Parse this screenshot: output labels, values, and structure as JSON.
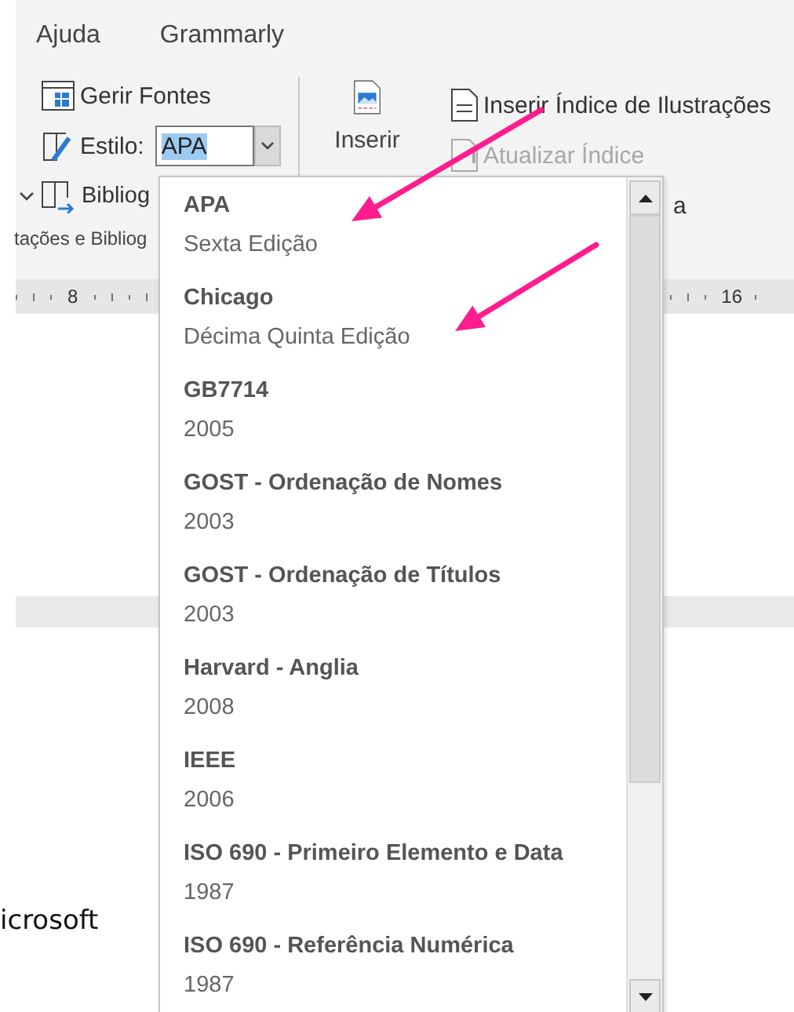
{
  "ribbon_tabs": [
    {
      "label": "Ajuda"
    },
    {
      "label": "Grammarly"
    }
  ],
  "citations_group": {
    "manage_sources": "Gerir Fontes",
    "style_label": "Estilo:",
    "style_value": "APA",
    "bibliography": "Bibliog",
    "group_label": "tações e Bibliog"
  },
  "captions_group": {
    "insert_caption": "Inserir",
    "insert_table_of_figures": "Inserir Índice de Ilustrações",
    "update_table": {
      "label": "Atualizar Índice",
      "disabled": true
    },
    "cross_reference": "a"
  },
  "ruler": {
    "labels": [
      "8",
      "16"
    ]
  },
  "document": {
    "text": "icrosoft"
  },
  "style_dropdown": {
    "items": [
      {
        "name": "APA",
        "edition": "Sexta Edição"
      },
      {
        "name": "Chicago",
        "edition": "Décima Quinta Edição"
      },
      {
        "name": "GB7714",
        "edition": "2005"
      },
      {
        "name": "GOST - Ordenação de Nomes",
        "edition": "2003"
      },
      {
        "name": "GOST - Ordenação de Títulos",
        "edition": "2003"
      },
      {
        "name": "Harvard - Anglia",
        "edition": "2008"
      },
      {
        "name": "IEEE",
        "edition": "2006"
      },
      {
        "name": "ISO 690 - Primeiro Elemento e Data",
        "edition": "1987"
      },
      {
        "name": "ISO 690 - Referência Numérica",
        "edition": "1987"
      }
    ]
  },
  "annotations": [
    {
      "kind": "arrow"
    },
    {
      "kind": "arrow"
    }
  ]
}
